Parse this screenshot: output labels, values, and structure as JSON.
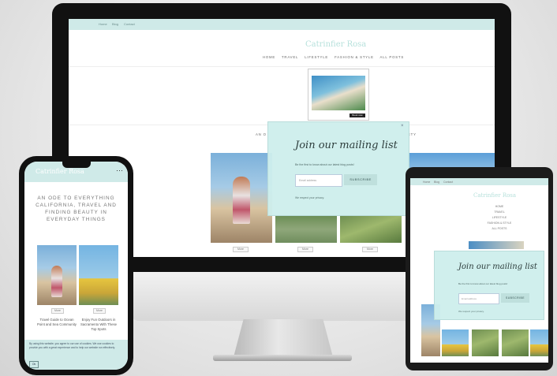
{
  "imac": {
    "topbar_links": [
      "Home",
      "Blog",
      "Contact"
    ],
    "topbar_left": "",
    "logo": "Catrinfier Rosa",
    "nav": [
      "HOME",
      "TRAVEL",
      "LIFESTYLE",
      "FASHION & STYLE",
      "ALL POSTS"
    ],
    "ad_button": "Book now",
    "tagline_left": "AN O",
    "tagline_right": "ETY",
    "popup": {
      "title": "Join our mailing list",
      "subtitle": "Be the first to know about our latest blog posts!",
      "email_placeholder": "Email address",
      "button": "SUBSCRIBE",
      "footer": "We respect your privacy.",
      "close": "×"
    },
    "card_buttons": [
      "More",
      "More",
      "More"
    ]
  },
  "phone": {
    "logo": "Catrinfier Rosa",
    "menu_icon": "⋯",
    "tagline": "AN ODE TO EVERYTHING CALIFORNIA, TRAVEL AND FINDING BEAUTY IN EVERYDAY THINGS",
    "posts": [
      {
        "title": "Travel Guide to Ocean Point and Sea Community",
        "button": "More"
      },
      {
        "title": "Enjoy Fun Outdoors in Sacramento With These Top Spots",
        "button": "More"
      }
    ],
    "cookie_text": "By using this website, you agree to our use of cookies. We use cookies to provide you with a great experience and to help our website run effectively.",
    "cookie_button": "Ok"
  },
  "tablet": {
    "topbar_links": [
      "Home",
      "Blog",
      "Contact"
    ],
    "logo": "Catrinfier Rosa",
    "nav": [
      "HOME",
      "TRAVEL",
      "LIFESTYLE",
      "FASHION & STYLE",
      "ALL POSTS"
    ],
    "popup": {
      "title": "Join our mailing list",
      "subtitle": "Be the first to know about our latest blog posts!",
      "email_placeholder": "Email address",
      "button": "SUBSCRIBE",
      "footer": "We respect your privacy."
    }
  },
  "colors": {
    "mint": "#cfeae8",
    "popup": "#cdeeec",
    "device": "#111111"
  }
}
